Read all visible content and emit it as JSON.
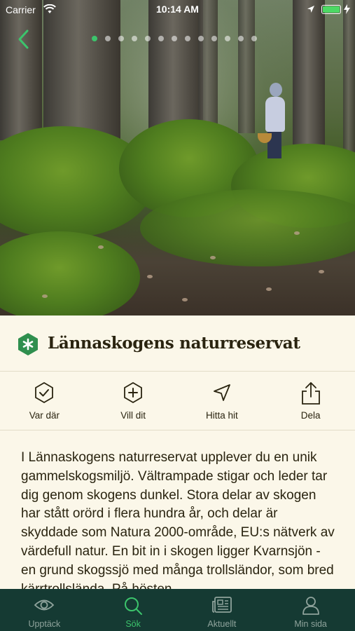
{
  "status_bar": {
    "carrier": "Carrier",
    "time": "10:14 AM",
    "battery_color": "#4cd964"
  },
  "hero": {
    "pager_count": 13,
    "pager_active_index": 0,
    "back_icon": "chevron-left-icon"
  },
  "place": {
    "icon": "hexagon-asterisk-icon",
    "title": "Lännaskogens naturreservat"
  },
  "actions": [
    {
      "label": "Var där",
      "icon": "check-circle-icon"
    },
    {
      "label": "Vill dit",
      "icon": "plus-circle-icon"
    },
    {
      "label": "Hitta hit",
      "icon": "navigation-arrow-icon"
    },
    {
      "label": "Dela",
      "icon": "share-icon"
    }
  ],
  "description": "I Lännaskogens naturreservat upplever du en unik gammelskogsmiljö. Vältrampade stigar och leder tar dig genom skogens dunkel. Stora delar av skogen har stått orörd i flera hundra år, och delar är skyddade som Natura 2000-område, EU:s nätverk av värdefull natur. En bit in i skogen ligger Kvarnsjön - en grund skogssjö med många trollsländor, som bred kärrtrollslända. På hösten",
  "tabbar": [
    {
      "label": "Upptäck",
      "icon": "eye-icon",
      "active": false
    },
    {
      "label": "Sök",
      "icon": "search-icon",
      "active": true
    },
    {
      "label": "Aktuellt",
      "icon": "newspaper-icon",
      "active": false
    },
    {
      "label": "Min sida",
      "icon": "user-icon",
      "active": false
    }
  ],
  "colors": {
    "accent": "#3cc46c",
    "brand_green": "#2f8f4e",
    "tabbar_bg": "#153a33",
    "card_bg": "#fbf7e9",
    "text": "#2a2410"
  }
}
